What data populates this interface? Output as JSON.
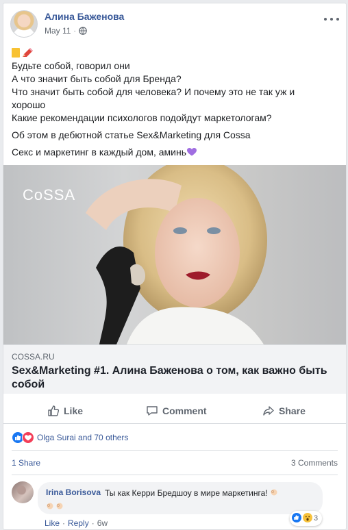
{
  "post": {
    "author": "Алина Баженова",
    "date": "May 11",
    "separator": "·",
    "lines": [
      "Будьте собой, говорил они",
      "А что значит быть собой для Бренда?",
      "Что значит быть собой для человека? И почему это не так уж и",
      "хорошо",
      "Какие рекомендации психологов подойдут маркетологам?"
    ],
    "line_about": "Об этом в дебютной статье Sex&Marketing для Cossa",
    "line_closing": "Секс и маркетинг в каждый дом, аминь",
    "icons": [
      "globe-icon",
      "more-icon",
      "memo-emoji",
      "pencil-emoji",
      "purple-heart-emoji"
    ]
  },
  "link_preview": {
    "logo_text": "CoSSA",
    "domain": "COSSA.RU",
    "title": "Sex&Marketing #1. Алина Баженова о том, как важно быть собой"
  },
  "actions": {
    "like": "Like",
    "comment": "Comment",
    "share": "Share"
  },
  "reactions": {
    "summary": "Olga Surai and 70 others",
    "shares": "1 Share",
    "comments": "3 Comments"
  },
  "comment": {
    "author": "Irina Borisova",
    "text": "Ты как Керри Бредшоу в мире маркетинга!",
    "reaction_count": "3",
    "like": "Like",
    "reply": "Reply",
    "sep": "·",
    "time": "6w"
  },
  "colors": {
    "link_blue": "#385898",
    "like_blue": "#1877f2",
    "love_red": "#f33e58",
    "background": "#e9ebee"
  }
}
